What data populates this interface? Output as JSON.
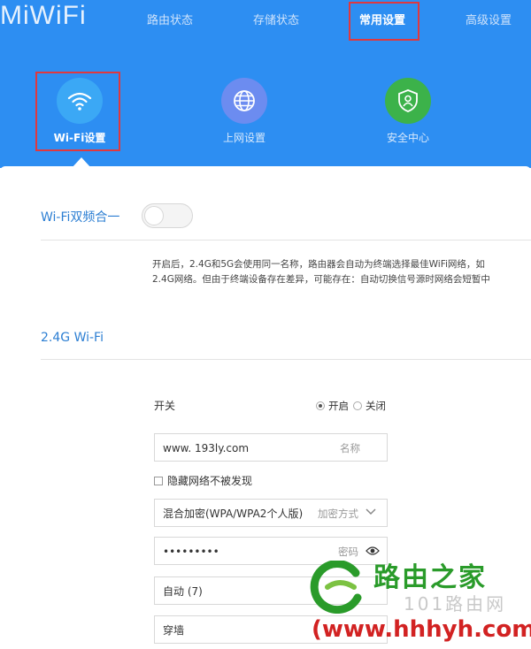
{
  "header": {
    "logo": "MiWiFi",
    "nav": [
      {
        "label": "路由状态",
        "active": false
      },
      {
        "label": "存储状态",
        "active": false
      },
      {
        "label": "常用设置",
        "active": true
      },
      {
        "label": "高级设置",
        "active": false
      }
    ],
    "subnav": [
      {
        "label": "Wi-Fi设置",
        "icon": "wifi-icon",
        "color": "#3ba8f5",
        "active": true
      },
      {
        "label": "上网设置",
        "icon": "globe-icon",
        "color": "#6c8cf0",
        "active": false
      },
      {
        "label": "安全中心",
        "icon": "shield-icon",
        "color": "#3cb24a",
        "active": false
      }
    ]
  },
  "dual_band": {
    "title": "Wi-Fi双频合一",
    "toggle_on": false,
    "desc_line1": "开启后，2.4G和5G会使用同一名称，路由器会自动为终端选择最佳WiFi网络，如",
    "desc_line2": "2.4G网络。但由于终端设备存在差异，可能存在：自动切换信号源时网络会短暂中"
  },
  "wifi24": {
    "title": "2.4G Wi-Fi",
    "switch_label": "开关",
    "radio_on": "开启",
    "radio_off": "关闭",
    "radio_selected": "on",
    "ssid_value": "www. 193ly.com",
    "ssid_hint": "名称",
    "hide_label": "隐藏网络不被发现",
    "encryption_value": "混合加密(WPA/WPA2个人版)",
    "encryption_hint": "加密方式",
    "password_value": "•••••••••",
    "password_hint": "密码",
    "channel_value": "自动 (7)",
    "strength_value": "穿墙"
  },
  "watermark": {
    "brand": "路由之家",
    "sub": "101路由网",
    "url": "(www.hhhyh.com)"
  },
  "colors": {
    "header_bg": "#2d8ef2",
    "highlight": "#e0383e",
    "accent_text": "#2d7fd3"
  }
}
